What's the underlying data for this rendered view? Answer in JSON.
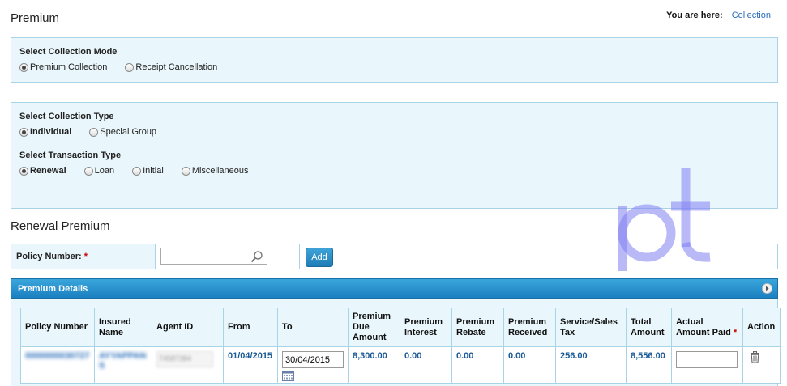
{
  "page": {
    "title": "Premium"
  },
  "breadcrumb": {
    "label": "You are here:",
    "link": "Collection"
  },
  "collection_mode": {
    "title": "Select Collection Mode",
    "options": [
      {
        "label": "Premium Collection",
        "selected": true
      },
      {
        "label": "Receipt Cancellation",
        "selected": false
      }
    ]
  },
  "collection_type": {
    "title": "Select Collection Type",
    "options": [
      {
        "label": "Individual",
        "selected": true
      },
      {
        "label": "Special Group",
        "selected": false
      }
    ]
  },
  "transaction_type": {
    "title": "Select Transaction Type",
    "options": [
      {
        "label": "Renewal",
        "selected": true
      },
      {
        "label": "Loan",
        "selected": false
      },
      {
        "label": "Initial",
        "selected": false
      },
      {
        "label": "Miscellaneous",
        "selected": false
      }
    ]
  },
  "renewal": {
    "title": "Renewal Premium",
    "policy_label": "Policy Number:",
    "required_mark": "*",
    "policy_value": "",
    "add_label": "Add"
  },
  "details": {
    "title": "Premium Details",
    "columns": [
      "Policy Number",
      "Insured Name",
      "Agent ID",
      "From",
      "To",
      "Premium Due Amount",
      "Premium Interest",
      "Premium Rebate",
      "Premium Received",
      "Service/Sales Tax",
      "Total Amount",
      "Actual Amount Paid",
      "Action"
    ],
    "actual_required_mark": "*",
    "row": {
      "policy_number": "0000000030727",
      "insured_name": "AYYAPPAN S",
      "agent_id": "74587384",
      "from": "01/04/2015",
      "to": "30/04/2015",
      "premium_due": "8,300.00",
      "interest": "0.00",
      "rebate": "0.00",
      "received": "0.00",
      "tax": "256.00",
      "total": "8,556.00",
      "actual_paid": ""
    }
  },
  "colors": {
    "accent": "#1b7fc0",
    "panel_bg": "#e9f6fb",
    "panel_border": "#a9d3e6",
    "value_text": "#1a5a96"
  }
}
